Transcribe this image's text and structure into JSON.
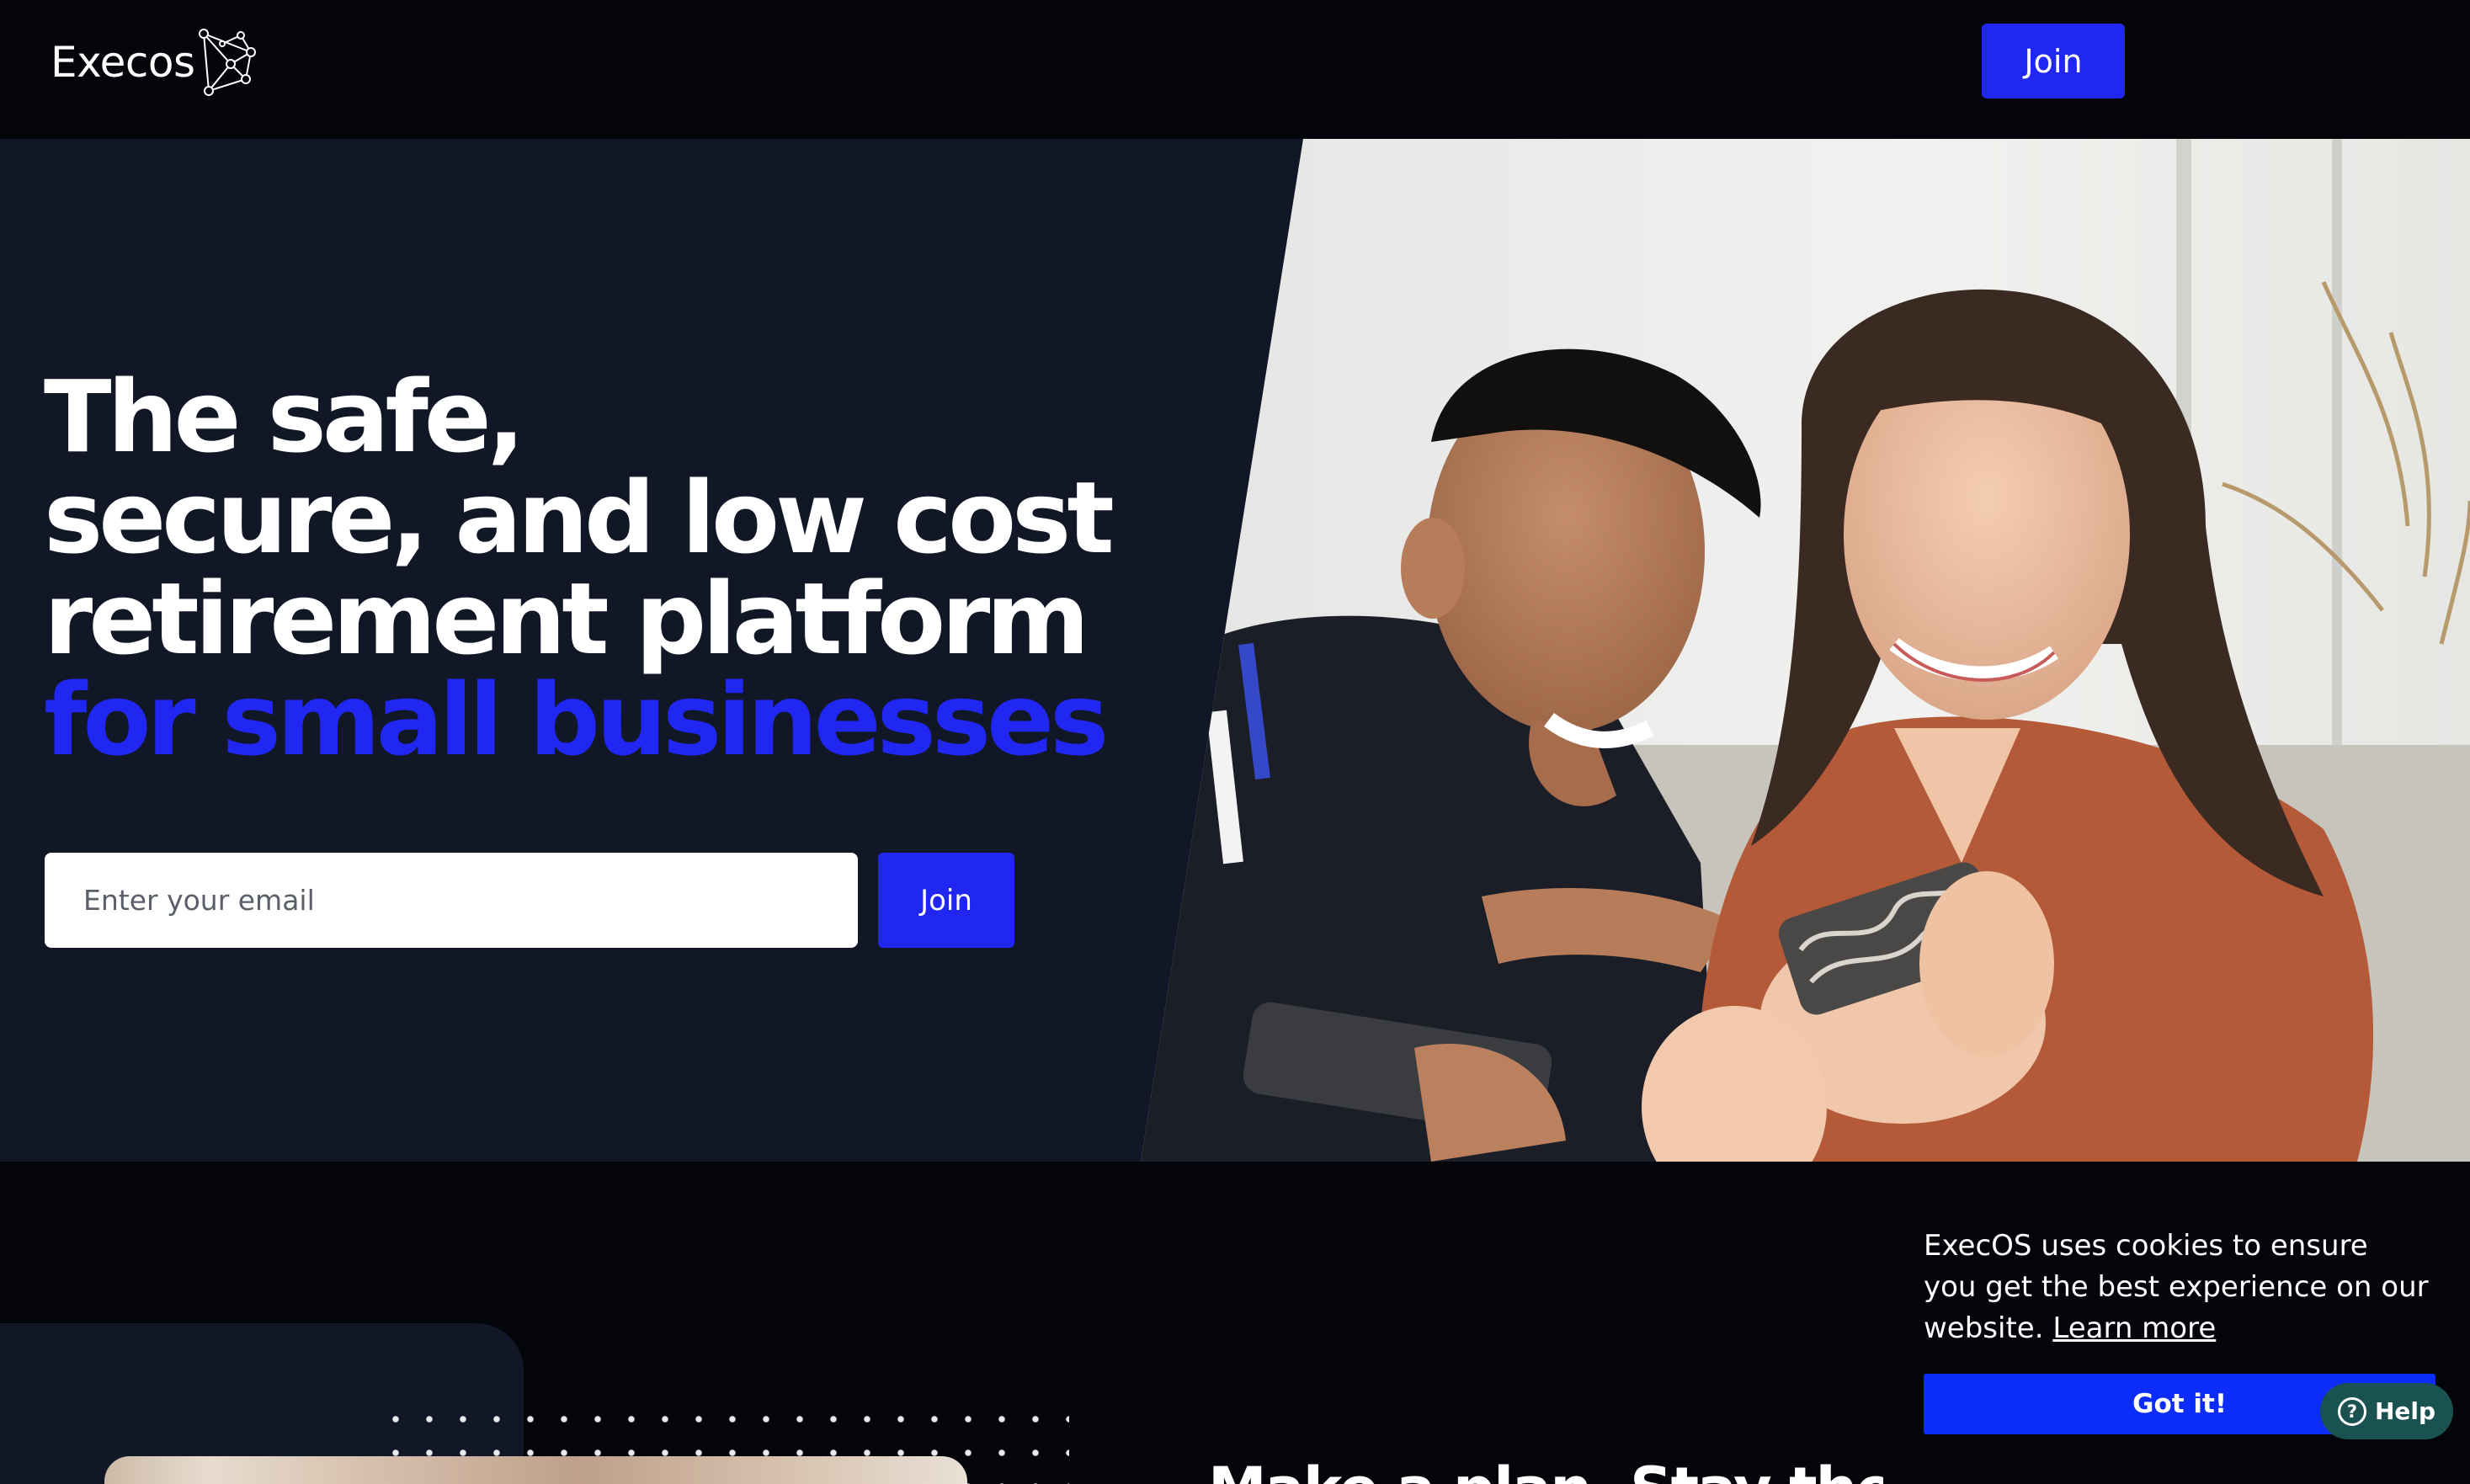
{
  "brand": {
    "name": "Execos",
    "logo_icon": "network-node-icon"
  },
  "header": {
    "join_label": "Join"
  },
  "hero": {
    "title_lines": [
      "The safe,",
      "secure, and low cost",
      "retirement platform"
    ],
    "title_accent": "for small businesses",
    "email_placeholder": "Enter your email",
    "join_label": "Join",
    "image": "couple-looking-at-phones-photo"
  },
  "section": {
    "heading": "Make a plan. Stay the course."
  },
  "cookie_banner": {
    "message": "ExecOS uses cookies to ensure you get the best experience on our website.",
    "link_label": "Learn more",
    "accept_label": "Got it!"
  },
  "help_widget": {
    "label": "Help",
    "icon": "question-circle-icon"
  },
  "colors": {
    "accent": "#2127f2",
    "page_bg": "#03050b",
    "hero_bg": "#111727",
    "help_bg": "#1a5252"
  }
}
